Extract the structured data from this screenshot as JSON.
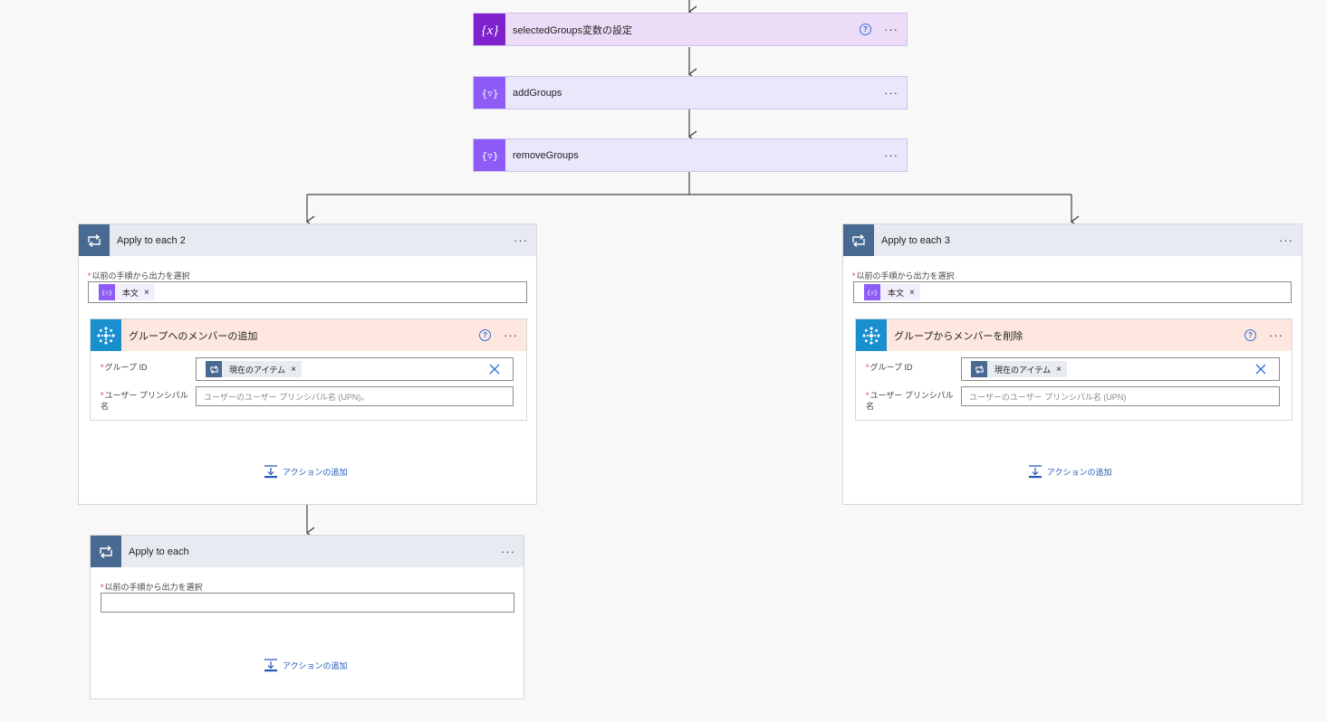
{
  "flow": {
    "set_variable": {
      "title": "selectedGroups変数の設定",
      "icon": "variable-icon",
      "help": "?",
      "more": "···"
    },
    "add_groups": {
      "title": "addGroups",
      "icon": "compose-icon",
      "more": "···"
    },
    "remove_groups": {
      "title": "removeGroups",
      "icon": "compose-icon",
      "more": "···"
    },
    "loop2": {
      "title": "Apply to each 2",
      "more": "···",
      "select_label": "以前の手順から出力を選択",
      "token": "本文",
      "inner": {
        "title": "グループへのメンバーの追加",
        "help": "?",
        "more": "···",
        "group_id_label": "グループ ID",
        "group_token": "現在のアイテム",
        "upn_label_line1": "ユーザー プリンシパル",
        "upn_label_line2": "名",
        "upn_placeholder": "ユーザーのユーザー プリンシパル名 (UPN)。"
      },
      "add_action": "アクションの追加"
    },
    "loop3": {
      "title": "Apply to each 3",
      "more": "···",
      "select_label": "以前の手順から出力を選択",
      "token": "本文",
      "inner": {
        "title": "グループからメンバーを削除",
        "help": "?",
        "more": "···",
        "group_id_label": "グループ ID",
        "group_token": "現在のアイテム",
        "upn_label_line1": "ユーザー プリンシパル",
        "upn_label_line2": "名",
        "upn_placeholder": "ユーザーのユーザー プリンシパル名 (UPN)"
      },
      "add_action": "アクションの追加"
    },
    "loop1": {
      "title": "Apply to each",
      "more": "···",
      "select_label": "以前の手順から出力を選択",
      "add_action": "アクションの追加"
    }
  },
  "required_mark": "*",
  "token_remove": "×",
  "colors": {
    "variable": "#7e22ce",
    "compose": "#8d5cf6",
    "loop": "#486991",
    "azure_ad": "#1a8fd0",
    "link": "#2358b8",
    "required": "#d13438"
  }
}
